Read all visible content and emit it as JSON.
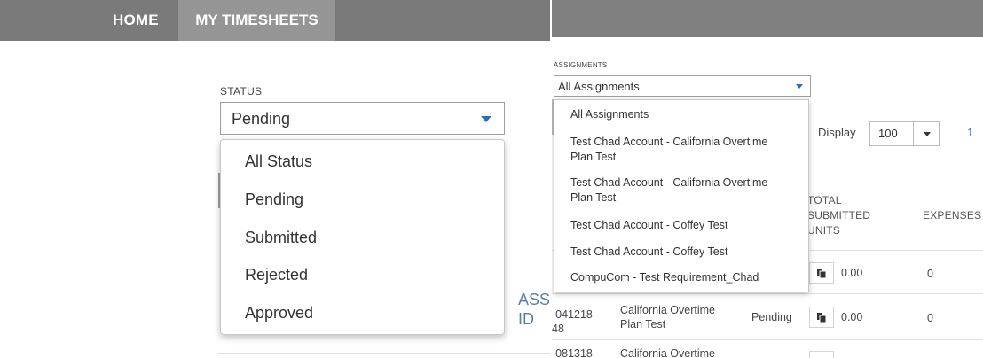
{
  "nav": {
    "home": "HOME",
    "timesheets": "MY TIMESHEETS"
  },
  "status_filter": {
    "label": "STATUS",
    "selected": "Pending",
    "options": [
      "All Status",
      "Pending",
      "Submitted",
      "Rejected",
      "Approved"
    ]
  },
  "assignments_filter": {
    "label": "ASSIGNMENTS",
    "selected": "All Assignments",
    "options": [
      "All Assignments",
      "Test Chad Account - California Overtime Plan Test",
      "Test Chad Account - California Overtime Plan Test",
      "Test Chad Account - Coffey Test",
      "Test Chad Account - Coffey Test",
      "CompuCom - Test Requirement_Chad"
    ]
  },
  "pagination": {
    "display_label": "Display",
    "page_size": "100",
    "page": "1"
  },
  "table": {
    "assignment_header_line1": "ASSI",
    "assignment_header_line2": "ID",
    "total_units_header_line1": "TOTAL",
    "total_units_header_line2": "SUBMITTED",
    "total_units_header_line3": "UNITS",
    "expenses_header": "EXPENSES",
    "rows": [
      {
        "id_line1": "",
        "id_line2": "",
        "assignment_line1": "",
        "assignment_line2": "",
        "status": "",
        "units": "0.00",
        "expenses": "0"
      },
      {
        "id_line1": "-041218-",
        "id_line2": "48",
        "assignment_line1": "California Overtime",
        "assignment_line2": "Plan Test",
        "status": "Pending",
        "units": "0.00",
        "expenses": "0"
      },
      {
        "id_line1": "-081318-",
        "id_line2": "",
        "assignment_line1": "California Overtime",
        "assignment_line2": "",
        "status": "",
        "units": "",
        "expenses": ""
      }
    ]
  }
}
